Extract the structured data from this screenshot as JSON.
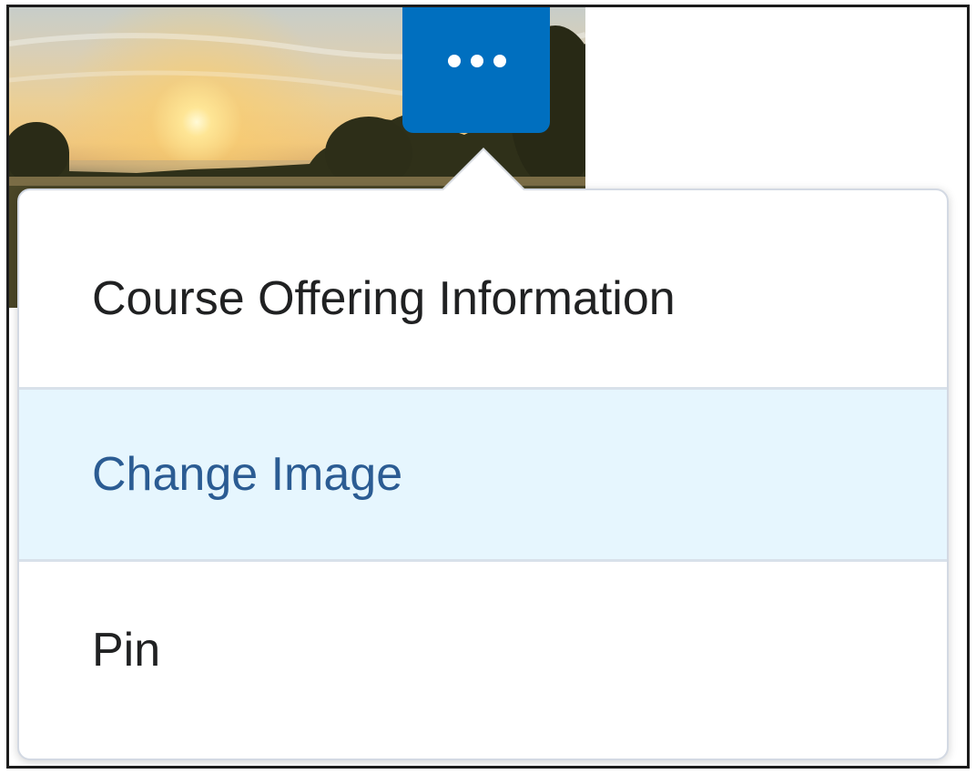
{
  "course_card": {
    "image_description_icon": "sunrise-landscape-image",
    "more_button_icon": "more-options-icon",
    "accent_color": "#006fbf"
  },
  "menu": {
    "items": [
      {
        "label": "Course Offering Information",
        "state": "default"
      },
      {
        "label": "Change Image",
        "state": "hovered"
      },
      {
        "label": "Pin",
        "state": "default"
      }
    ],
    "hover_background": "#e6f6fe",
    "hover_text_color": "#2b5c93"
  }
}
